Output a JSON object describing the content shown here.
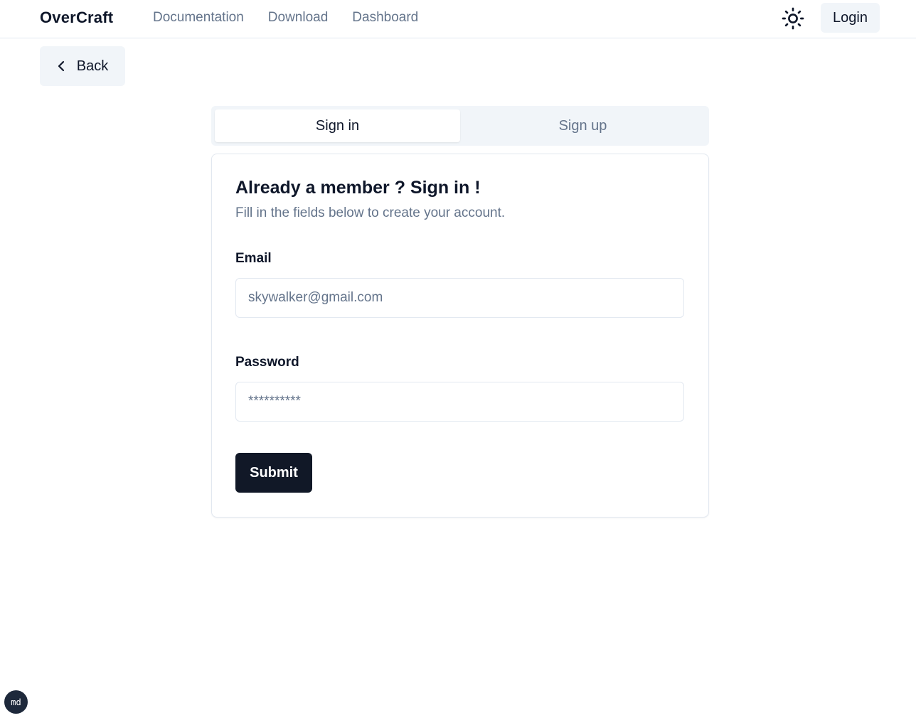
{
  "navbar": {
    "brand": "OverCraft",
    "links": [
      "Documentation",
      "Download",
      "Dashboard"
    ],
    "theme_toggle_icon": "sun-icon",
    "login_label": "Login"
  },
  "back_button": {
    "label": "Back",
    "icon": "chevron-left-icon"
  },
  "tabs": [
    {
      "label": "Sign in",
      "active": true
    },
    {
      "label": "Sign up",
      "active": false
    }
  ],
  "card": {
    "title": "Already a member ? Sign in !",
    "subtitle": "Fill in the fields below to create your account.",
    "email": {
      "label": "Email",
      "placeholder": "skywalker@gmail.com",
      "value": ""
    },
    "password": {
      "label": "Password",
      "placeholder": "**********",
      "value": ""
    },
    "submit_label": "Submit"
  },
  "dev_badge": {
    "label": "md"
  },
  "colors": {
    "primary": "#111827",
    "muted_text": "#64748b",
    "muted_bg": "#f1f5f9",
    "border": "#e2e8f0"
  }
}
